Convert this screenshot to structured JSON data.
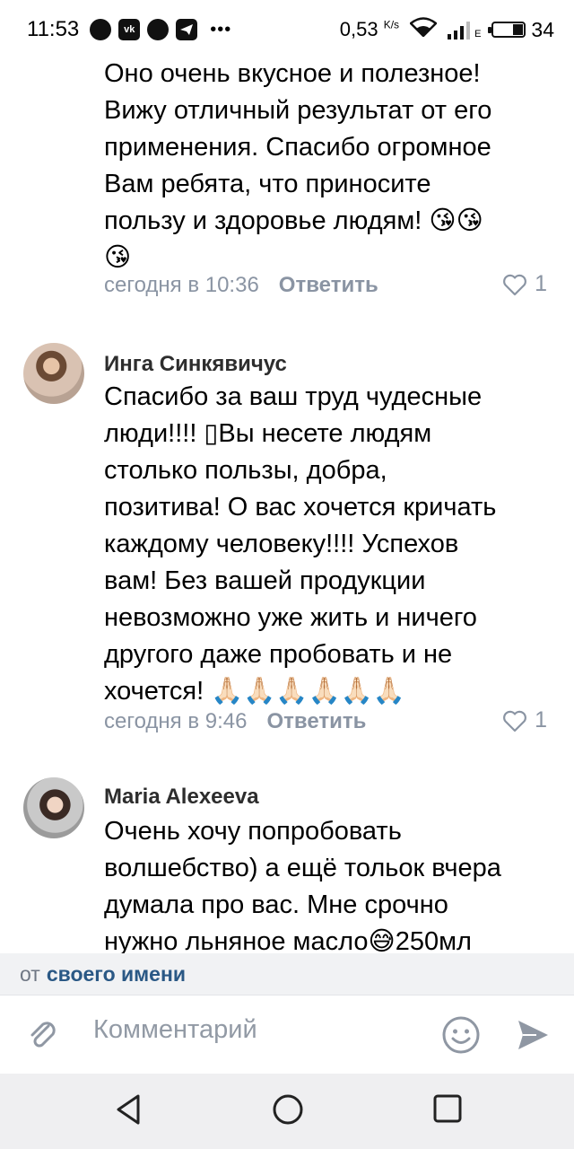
{
  "status_bar": {
    "time": "11:53",
    "app_icons": [
      "message-bubble-icon",
      "vk-icon",
      "whatsapp-icon",
      "telegram-icon"
    ],
    "overflow": "•••",
    "speed_value": "0,53",
    "speed_unit": "K/s",
    "network_letter": "E",
    "battery": "34",
    "battery_fraction": 0.34
  },
  "comments": [
    {
      "lines": [
        "Оно очень вкусное и полезное!",
        "Вижу отличный результат от его",
        "применения. Спасибо огромное",
        "Вам ребята, что приносите",
        "пользу и здоровье людям! 😘😘",
        "😘"
      ],
      "time": "сегодня в 10:36",
      "reply_label": "Ответить",
      "likes": "1"
    },
    {
      "author": "Инга Синкявичус",
      "lines": [
        "Спасибо за ваш труд чудесные",
        "люди!!!! ▯Вы несете людям",
        "столько пользы, добра,",
        "позитива! О вас хочется кричать",
        "каждому человеку!!!! Успехов",
        "вам! Без вашей продукции",
        "невозможно уже жить и ничего",
        "другого даже пробовать и не",
        "хочется! 🙏🏻🙏🏻🙏🏻🙏🏻🙏🏻🙏🏻"
      ],
      "time": "сегодня в 9:46",
      "reply_label": "Ответить",
      "likes": "1"
    },
    {
      "author": "Maria Alexeeva",
      "lines": [
        "Очень хочу попробовать",
        "волшебство) а ещё тольок вчера",
        "думала про вас. Мне срочно",
        "нужно льняное масло😅250мл"
      ]
    }
  ],
  "reply_as": {
    "prefix": "от",
    "link": "своего имени"
  },
  "composer": {
    "placeholder": "Комментарий"
  },
  "colors": {
    "meta_gray": "#8a94a3",
    "link_blue": "#2a5885",
    "icon_gray": "#8f97a3"
  }
}
